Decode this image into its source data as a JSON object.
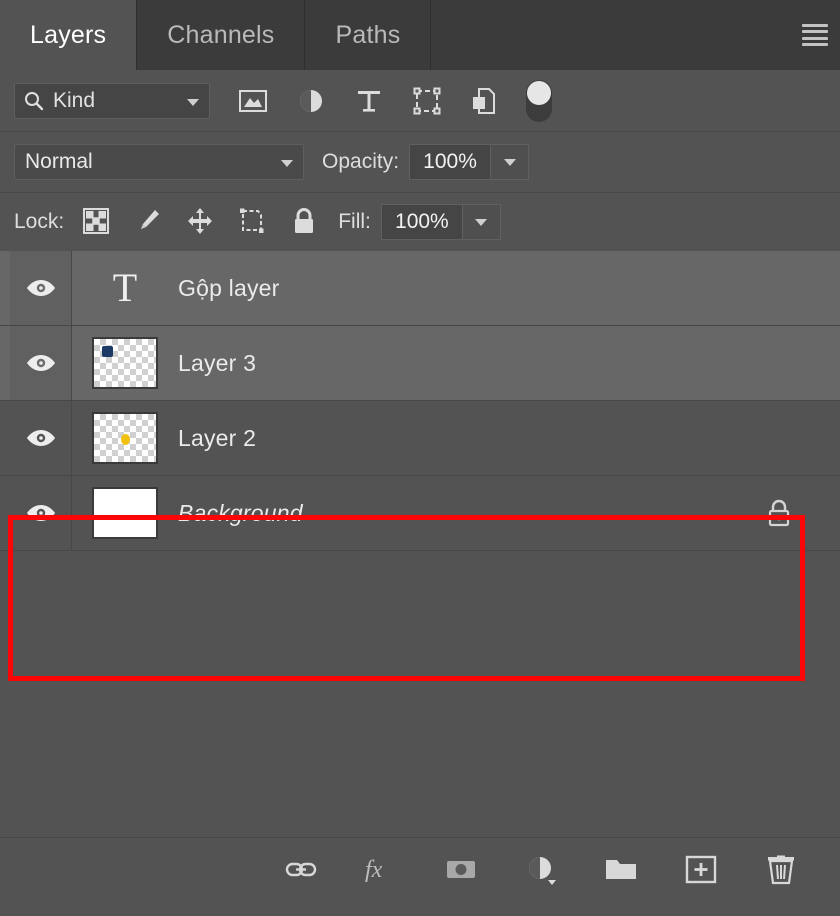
{
  "panel": {
    "title": "Layers",
    "tabs": [
      {
        "label": "Layers",
        "active": true
      },
      {
        "label": "Channels",
        "active": false
      },
      {
        "label": "Paths",
        "active": false
      }
    ],
    "menu_icon": "hamburger-menu-icon",
    "background_color": "#535353",
    "accent_color": "#fc0505"
  },
  "filter": {
    "search_icon": "search-icon",
    "kind_label": "Kind",
    "kind_chevron": "chevron-down-icon",
    "type_icons": [
      {
        "name": "pixel-layer-filter-icon"
      },
      {
        "name": "adjustment-layer-filter-icon"
      },
      {
        "name": "type-layer-filter-icon"
      },
      {
        "name": "shape-layer-filter-icon"
      },
      {
        "name": "smart-object-filter-icon"
      }
    ],
    "toggle_name": "filter-enable-toggle",
    "toggle_state": "off"
  },
  "blend": {
    "mode": "Normal",
    "mode_chevron": "chevron-down-icon",
    "opacity_label": "Opacity:",
    "opacity_value": "100%",
    "opacity_chevron": "chevron-down-icon"
  },
  "lock": {
    "label": "Lock:",
    "icons": [
      {
        "name": "lock-transparent-pixels-icon"
      },
      {
        "name": "lock-image-pixels-icon"
      },
      {
        "name": "lock-position-icon"
      },
      {
        "name": "lock-artboard-nesting-icon"
      },
      {
        "name": "lock-all-icon"
      }
    ],
    "fill_label": "Fill:",
    "fill_value": "100%",
    "fill_chevron": "chevron-down-icon"
  },
  "layers": [
    {
      "name": "Gộp layer",
      "kind": "type",
      "visible": true,
      "selected": true,
      "italic": false,
      "locked": false,
      "thumb_glyph": "T"
    },
    {
      "name": "Layer 3",
      "kind": "pixel",
      "visible": true,
      "selected": true,
      "italic": false,
      "locked": false,
      "thumb_blob_color": "#1b3a66"
    },
    {
      "name": "Layer 2",
      "kind": "pixel",
      "visible": true,
      "selected": false,
      "italic": false,
      "locked": false,
      "thumb_blob_color": "#f2c10d"
    },
    {
      "name": "Background",
      "kind": "background",
      "visible": true,
      "selected": false,
      "italic": true,
      "locked": true,
      "thumb_fill_color": "#ffffff"
    }
  ],
  "bottom_toolbar": [
    {
      "name": "link-layers-button",
      "icon": "link-chain-icon"
    },
    {
      "name": "layer-style-button",
      "icon": "fx-icon"
    },
    {
      "name": "add-layer-mask-button",
      "icon": "mask-icon"
    },
    {
      "name": "new-adjustment-layer-button",
      "icon": "half-circle-icon"
    },
    {
      "name": "new-group-button",
      "icon": "folder-icon"
    },
    {
      "name": "new-layer-button",
      "icon": "plus-square-icon"
    },
    {
      "name": "delete-layer-button",
      "icon": "trash-icon"
    }
  ]
}
